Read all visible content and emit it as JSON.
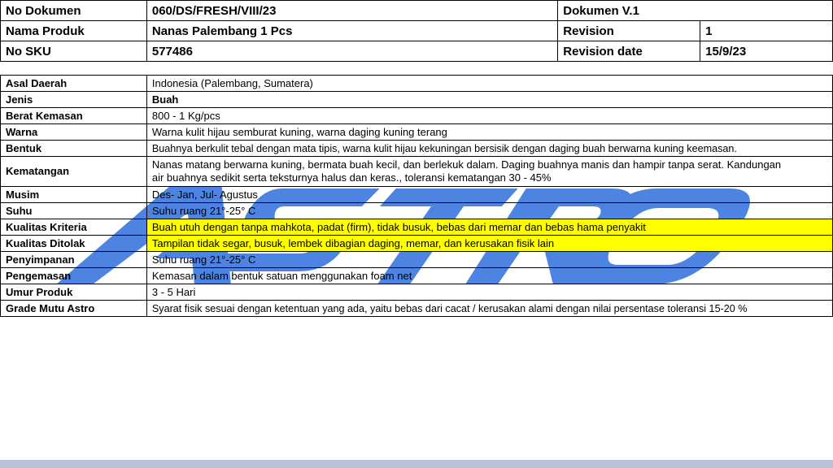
{
  "header": {
    "doc_no_label": "No Dokumen",
    "doc_no_value": "060/DS/FRESH/VIII/23",
    "doc_version": "Dokumen V.1",
    "product_name_label": "Nama Produk",
    "product_name_value": "Nanas Palembang 1 Pcs",
    "revision_label": "Revision",
    "revision_value": "1",
    "sku_label": "No SKU",
    "sku_value": "577486",
    "revision_date_label": "Revision date",
    "revision_date_value": "15/9/23"
  },
  "spec": [
    {
      "label": "Asal Daerah",
      "value": "Indonesia (Palembang, Sumatera)"
    },
    {
      "label": "Jenis",
      "value": "Buah"
    },
    {
      "label": "Berat Kemasan",
      "value": "800 - 1 Kg/pcs"
    },
    {
      "label": "Warna",
      "value": "Warna kulit hijau semburat kuning, warna daging kuning terang"
    },
    {
      "label": "Bentuk",
      "value": "Buahnya berkulit tebal dengan mata tipis, warna kulit hijau kekuningan bersisik dengan daging buah berwarna kuning keemasan."
    },
    {
      "label": "Kematangan",
      "value": "Nanas matang berwarna kuning, bermata buah kecil, dan berlekuk dalam. Daging buahnya manis dan hampir tanpa serat. Kandungan air buahnya sedikit serta teksturnya halus dan keras., toleransi kematangan 30 - 45%"
    },
    {
      "label": "Musim",
      "value": "Des- Jan, Jul- Agustus"
    },
    {
      "label": "Suhu",
      "value": "Suhu ruang 21°-25° C"
    },
    {
      "label": "Kualitas Kriteria",
      "value": "Buah utuh dengan tanpa mahkota, padat (firm), tidak busuk, bebas dari memar dan  bebas hama penyakit"
    },
    {
      "label": "Kualitas Ditolak",
      "value": "Tampilan tidak segar, busuk, lembek dibagian daging, memar, dan kerusakan fisik lain"
    },
    {
      "label": "Penyimpanan",
      "value": "Suhu ruang 21°-25° C"
    },
    {
      "label": "Pengemasan",
      "value": "Kemasan dalam bentuk satuan menggunakan foam net"
    },
    {
      "label": "Umur Produk",
      "value": "3 - 5 Hari"
    },
    {
      "label": "Grade Mutu Astro",
      "value": "Syarat fisik sesuai dengan ketentuan yang ada, yaitu bebas dari cacat / kerusakan alami dengan  nilai persentase toleransi 15-20 %"
    }
  ],
  "watermark": {
    "text": "ASTRO"
  },
  "colors": {
    "highlight": "#ffff00",
    "watermark": "#2f6fdc",
    "footer": "#b9c1d9"
  }
}
